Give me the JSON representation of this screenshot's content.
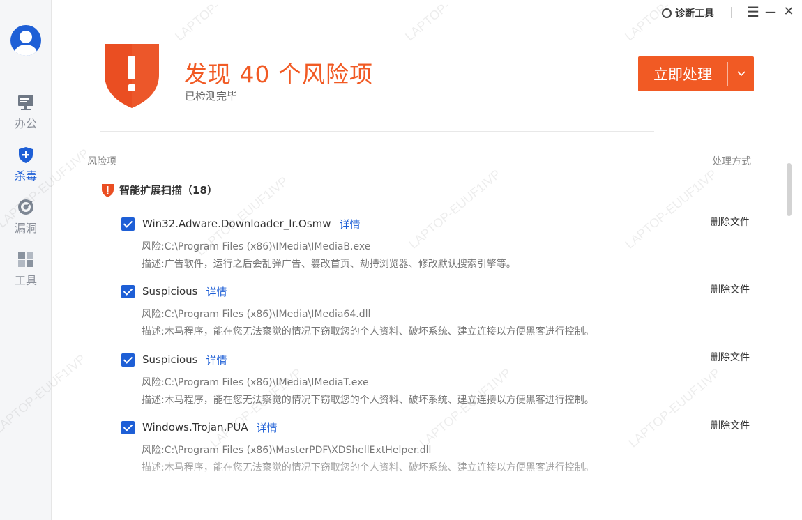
{
  "sidebar": {
    "items": [
      {
        "label": "办公",
        "icon": "monitor-icon"
      },
      {
        "label": "杀毒",
        "icon": "shield-plus-icon"
      },
      {
        "label": "漏洞",
        "icon": "radar-icon"
      },
      {
        "label": "工具",
        "icon": "grid-icon"
      }
    ],
    "active_color": "#1e5fd6"
  },
  "topbar": {
    "diag_label": "诊断工具",
    "menu_glyph": "☰",
    "min_glyph": "—",
    "close_glyph": "✕"
  },
  "header": {
    "title": "发现 40 个风险项",
    "subtitle": "已检测完毕",
    "action_label": "立即处理",
    "action_color": "#f15a24"
  },
  "list": {
    "col_risk": "风险项",
    "col_action": "处理方式",
    "group_label": "智能扩展扫描（18）",
    "detail_label": "详情",
    "delete_label": "删除文件",
    "items": [
      {
        "name": "Win32.Adware.Downloader_lr.Osmw",
        "path": "风险:C:\\Program Files (x86)\\IMedia\\IMediaB.exe",
        "desc": "描述:广告软件，运行之后会乱弹广告、篡改首页、劫持浏览器、修改默认搜索引擎等。"
      },
      {
        "name": "Suspicious",
        "path": "风险:C:\\Program Files (x86)\\IMedia\\IMedia64.dll",
        "desc": "描述:木马程序，能在您无法察觉的情况下窃取您的个人资料、破坏系统、建立连接以方便黑客进行控制。"
      },
      {
        "name": "Suspicious",
        "path": "风险:C:\\Program Files (x86)\\IMedia\\IMediaT.exe",
        "desc": "描述:木马程序，能在您无法察觉的情况下窃取您的个人资料、破坏系统、建立连接以方便黑客进行控制。"
      },
      {
        "name": "Windows.Trojan.PUA",
        "path": "风险:C:\\Program Files (x86)\\MasterPDF\\XDShellExtHelper.dll",
        "desc": "描述:木马程序，能在您无法察觉的情况下窃取您的个人资料、破坏系统、建立连接以方便黑客进行控制。"
      }
    ]
  },
  "watermark": "LAPTOP-EUUF1IVP"
}
